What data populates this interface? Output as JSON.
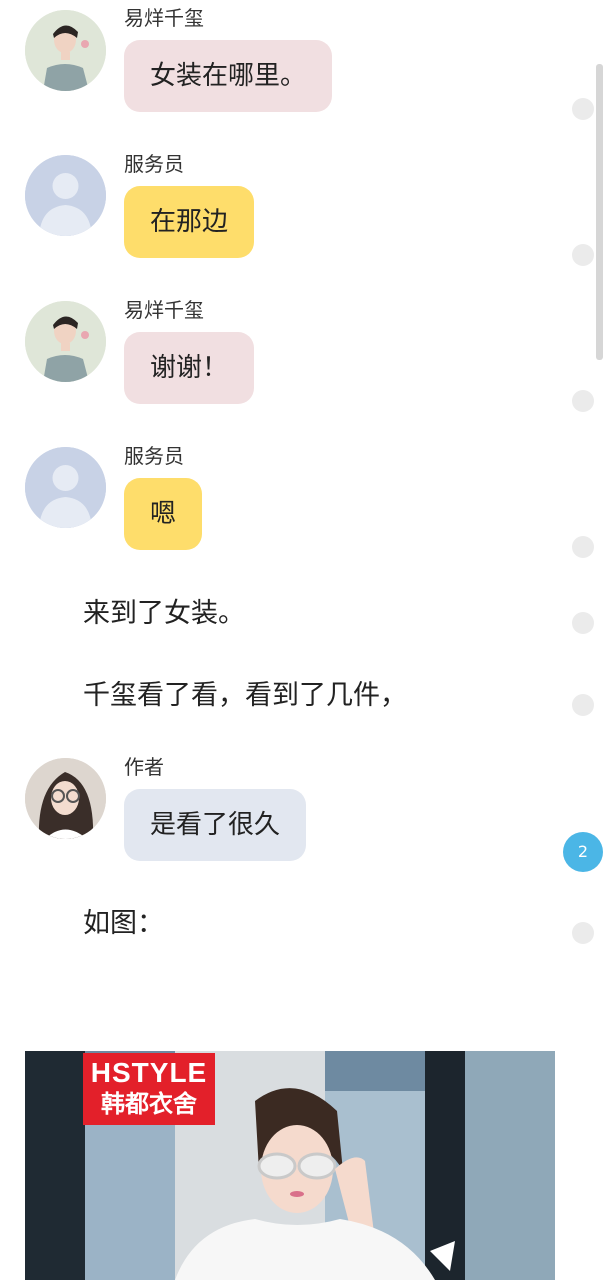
{
  "messages": [
    {
      "speaker": "易烊千玺",
      "text": "女装在哪里。",
      "avatar": "boy-avatar-icon"
    },
    {
      "speaker": "服务员",
      "text": "在那边",
      "avatar": "default-person-icon"
    },
    {
      "speaker": "易烊千玺",
      "text": "谢谢！",
      "avatar": "boy-avatar-icon"
    },
    {
      "speaker": "服务员",
      "text": "嗯",
      "avatar": "default-person-icon"
    },
    {
      "speaker": "作者",
      "text": "是看了很久",
      "avatar": "girl-avatar-icon"
    }
  ],
  "narration": [
    "来到了女装。",
    "千玺看了看，看到了几件，",
    "如图："
  ],
  "badge_count": "2",
  "photo": {
    "brand_line1": "HSTYLE",
    "brand_line2": "韩都衣舍"
  },
  "colors": {
    "bubble_pink": "#f1dfe1",
    "bubble_yellow": "#fedd6b",
    "bubble_gray": "#e2e7f0",
    "badge": "#4bb6e6",
    "brand_red": "#e3202a"
  }
}
